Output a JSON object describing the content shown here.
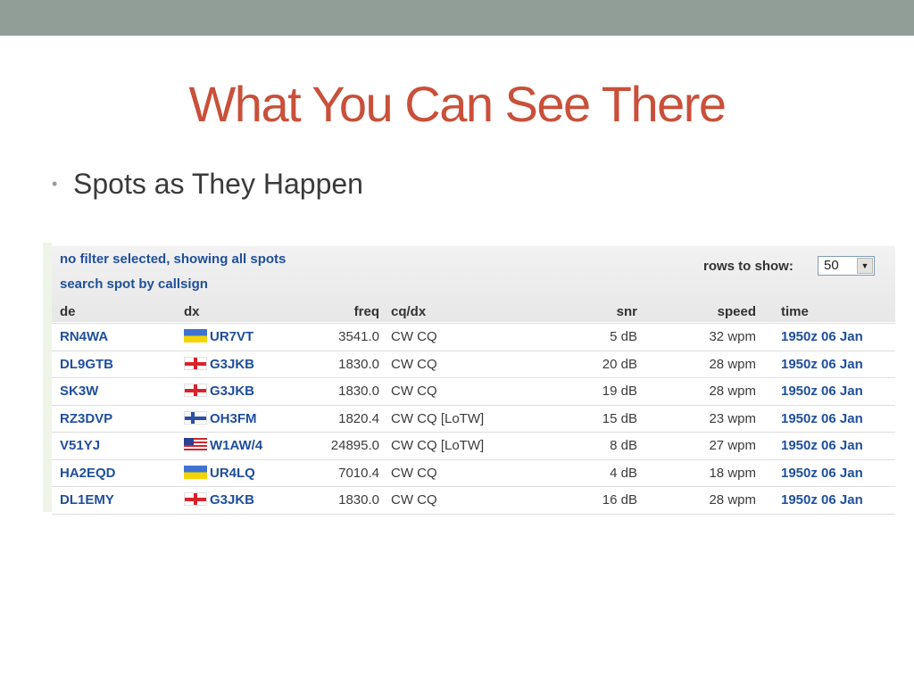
{
  "slide": {
    "title": "What You Can See There",
    "bullet": "Spots as They Happen"
  },
  "spots_panel": {
    "filter_link": "no filter selected, showing all spots",
    "search_link": "search spot by callsign",
    "rows_label": "rows to show:",
    "rows_value": "50",
    "columns": {
      "de": "de",
      "dx": "dx",
      "freq": "freq",
      "cqdx": "cq/dx",
      "snr": "snr",
      "speed": "speed",
      "time": "time"
    },
    "rows": [
      {
        "de": "RN4WA",
        "flag": "ukraine-flag-icon",
        "dx": "UR7VT",
        "freq": "3541.0",
        "cq": "CW CQ",
        "snr": "5 dB",
        "speed": "32 wpm",
        "time": "1950z 06 Jan"
      },
      {
        "de": "DL9GTB",
        "flag": "england-flag-icon",
        "dx": "G3JKB",
        "freq": "1830.0",
        "cq": "CW CQ",
        "snr": "20 dB",
        "speed": "28 wpm",
        "time": "1950z 06 Jan"
      },
      {
        "de": "SK3W",
        "flag": "england-flag-icon",
        "dx": "G3JKB",
        "freq": "1830.0",
        "cq": "CW CQ",
        "snr": "19 dB",
        "speed": "28 wpm",
        "time": "1950z 06 Jan"
      },
      {
        "de": "RZ3DVP",
        "flag": "finland-flag-icon",
        "dx": "OH3FM",
        "freq": "1820.4",
        "cq": "CW CQ [LoTW]",
        "snr": "15 dB",
        "speed": "23 wpm",
        "time": "1950z 06 Jan"
      },
      {
        "de": "V51YJ",
        "flag": "usa-flag-icon",
        "dx": "W1AW/4",
        "freq": "24895.0",
        "cq": "CW CQ [LoTW]",
        "snr": "8 dB",
        "speed": "27 wpm",
        "time": "1950z 06 Jan"
      },
      {
        "de": "HA2EQD",
        "flag": "ukraine-flag-icon",
        "dx": "UR4LQ",
        "freq": "7010.4",
        "cq": "CW CQ",
        "snr": "4 dB",
        "speed": "18 wpm",
        "time": "1950z 06 Jan"
      },
      {
        "de": "DL1EMY",
        "flag": "england-flag-icon",
        "dx": "G3JKB",
        "freq": "1830.0",
        "cq": "CW CQ",
        "snr": "16 dB",
        "speed": "28 wpm",
        "time": "1950z 06 Jan"
      }
    ]
  },
  "colors": {
    "title": "#c9503a",
    "top_bar": "#919d97",
    "link": "#1f4f9c"
  }
}
